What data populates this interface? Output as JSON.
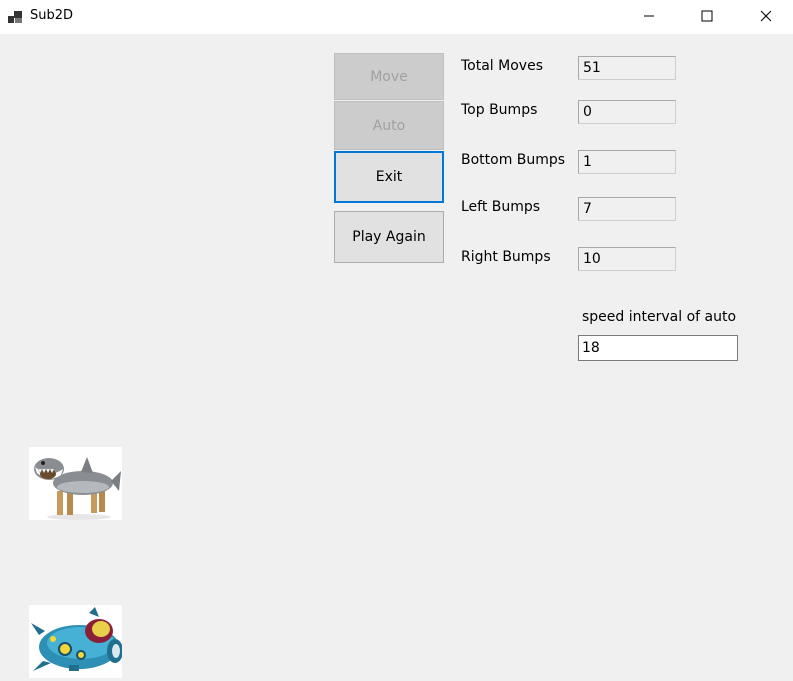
{
  "window": {
    "title": "Sub2D"
  },
  "buttons": {
    "move": "Move",
    "auto": "Auto",
    "exit": "Exit",
    "play_again": "Play Again"
  },
  "stats": [
    {
      "label": "Total Moves",
      "value": "51"
    },
    {
      "label": "Top Bumps",
      "value": "0"
    },
    {
      "label": "Bottom Bumps",
      "value": "1"
    },
    {
      "label": "Left Bumps",
      "value": "7"
    },
    {
      "label": "Right Bumps",
      "value": "10"
    }
  ],
  "speed": {
    "label": "speed interval of auto",
    "value": "18"
  },
  "icons": [
    "app-icon",
    "minimize-icon",
    "maximize-icon",
    "close-icon",
    "shark-dog-sprite",
    "submarine-sprite"
  ]
}
